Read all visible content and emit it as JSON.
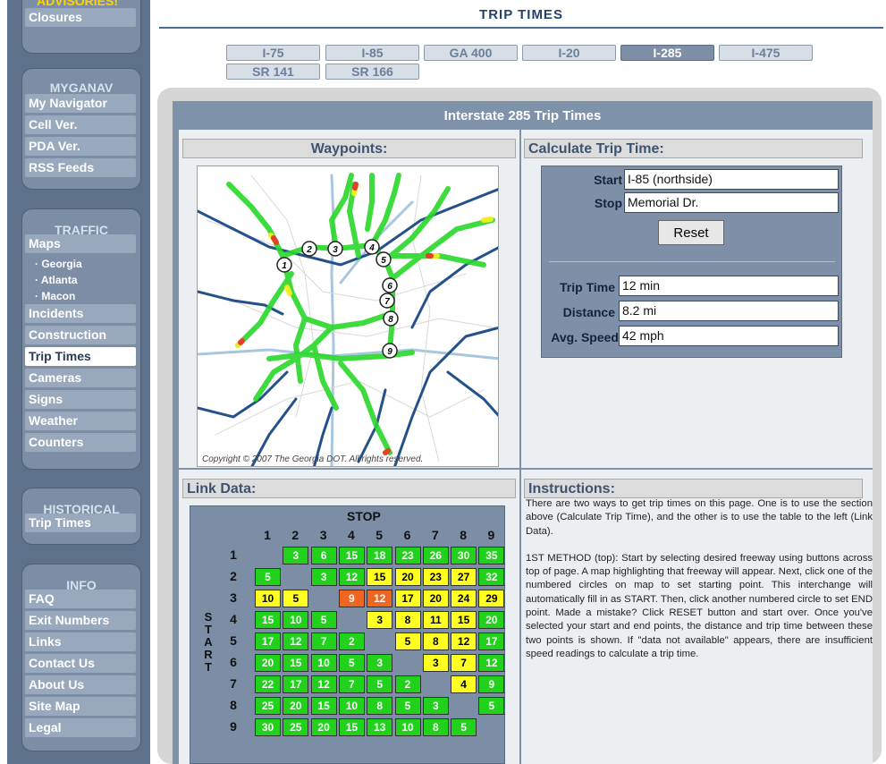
{
  "header": {
    "title": "TRIP TIMES"
  },
  "sidebar": {
    "top": {
      "partial_label": "ADVISORIES!",
      "items": [
        "Closures"
      ]
    },
    "mygan": {
      "title": "MYGANAV",
      "items": [
        "My Navigator",
        "Cell Ver.",
        "PDA Ver.",
        "RSS Feeds"
      ]
    },
    "traffic": {
      "title": "TRAFFIC",
      "maps_label": "Maps",
      "map_subitems": [
        "· Georgia",
        "· Atlanta",
        "· Macon"
      ],
      "items": [
        "Incidents",
        "Construction",
        "Trip Times",
        "Cameras",
        "Signs",
        "Weather",
        "Counters"
      ],
      "active": "Trip Times"
    },
    "historical": {
      "title": "HISTORICAL",
      "items": [
        "Trip Times"
      ]
    },
    "info": {
      "title": "INFO",
      "items": [
        "FAQ",
        "Exit Numbers",
        "Links",
        "Contact Us",
        "About Us",
        "Site Map",
        "Legal"
      ]
    }
  },
  "tabs": [
    "I-75",
    "I-85",
    "GA 400",
    "I-20",
    "I-285",
    "I-475",
    "SR 141",
    "SR 166"
  ],
  "active_tab": "I-285",
  "panel": {
    "title": "Interstate 285 Trip Times"
  },
  "waypoints": {
    "title": "Waypoints:",
    "copyright": "Copyright © 2007 The Georgia DOT.  All rights reserved.",
    "markers": [
      "1",
      "2",
      "3",
      "4",
      "5",
      "6",
      "7",
      "8",
      "9"
    ]
  },
  "calc": {
    "title": "Calculate Trip Time:",
    "start_label": "Start",
    "start_value": "I-85 (northside)",
    "stop_label": "Stop",
    "stop_value": "Memorial Dr.",
    "reset_label": "Reset",
    "trip_time_label": "Trip Time",
    "trip_time_value": "12 min",
    "distance_label": "Distance",
    "distance_value": "8.2 mi",
    "avg_speed_label": "Avg. Speed",
    "avg_speed_value": "42 mph"
  },
  "link_data": {
    "title": "Link Data:",
    "stop_label": "STOP",
    "start_letters": [
      "S",
      "T",
      "A",
      "R",
      "T"
    ],
    "col_headers": [
      "1",
      "2",
      "3",
      "4",
      "5",
      "6",
      "7",
      "8",
      "9"
    ],
    "row_headers": [
      "1",
      "2",
      "3",
      "4",
      "5",
      "6",
      "7",
      "8",
      "9"
    ],
    "rows": [
      [
        "",
        "3",
        "6",
        "15",
        "18",
        "23",
        "26",
        "30",
        "35"
      ],
      [
        "5",
        "",
        "3",
        "12",
        "15",
        "20",
        "23",
        "27",
        "32"
      ],
      [
        "10",
        "5",
        "",
        "9",
        "12",
        "17",
        "20",
        "24",
        "29"
      ],
      [
        "15",
        "10",
        "5",
        "",
        "3",
        "8",
        "11",
        "15",
        "20"
      ],
      [
        "17",
        "12",
        "7",
        "2",
        "",
        "5",
        "8",
        "12",
        "17"
      ],
      [
        "20",
        "15",
        "10",
        "5",
        "3",
        "",
        "3",
        "7",
        "12"
      ],
      [
        "22",
        "17",
        "12",
        "7",
        "5",
        "2",
        "",
        "4",
        "9"
      ],
      [
        "25",
        "20",
        "15",
        "10",
        "8",
        "5",
        "3",
        "",
        "5"
      ],
      [
        "30",
        "25",
        "20",
        "15",
        "13",
        "10",
        "8",
        "5",
        ""
      ]
    ],
    "status": [
      [
        "",
        "g",
        "g",
        "g",
        "g",
        "g",
        "g",
        "g",
        "g"
      ],
      [
        "g",
        "",
        "g",
        "g",
        "y",
        "y",
        "y",
        "y",
        "g"
      ],
      [
        "y",
        "y",
        "",
        "o",
        "o",
        "y",
        "y",
        "y",
        "y"
      ],
      [
        "g",
        "g",
        "g",
        "",
        "y",
        "y",
        "y",
        "y",
        "g"
      ],
      [
        "g",
        "g",
        "g",
        "g",
        "",
        "y",
        "y",
        "y",
        "g"
      ],
      [
        "g",
        "g",
        "g",
        "g",
        "g",
        "",
        "y",
        "y",
        "g"
      ],
      [
        "g",
        "g",
        "g",
        "g",
        "g",
        "g",
        "",
        "y",
        "g"
      ],
      [
        "g",
        "g",
        "g",
        "g",
        "g",
        "g",
        "g",
        "",
        "g"
      ],
      [
        "g",
        "g",
        "g",
        "g",
        "g",
        "g",
        "g",
        "g",
        ""
      ]
    ],
    "colors": {
      "g": "#22d11b",
      "y": "#ffff22",
      "o": "#ee6622"
    }
  },
  "instructions": {
    "title": "Instructions:",
    "p1": "There are two ways to get trip times on this page. One is to use the section above (Calculate Trip Time), and the other is to use the table to the left (Link Data).",
    "p2": "1ST METHOD (top): Start by selecting desired freeway using buttons across top of page. A map highlighting that freeway will appear. Next, click one of the numbered circles on map to set starting point. This interchange will automatically fill in as START. Then, click another numbered circle to set END point. Made a mistake? Click RESET button and start over. Once you've selected your start and end points, the distance and trip time between these two points is shown. If \"data not available\" appears, there are insufficient speed readings to calculate a trip time."
  }
}
